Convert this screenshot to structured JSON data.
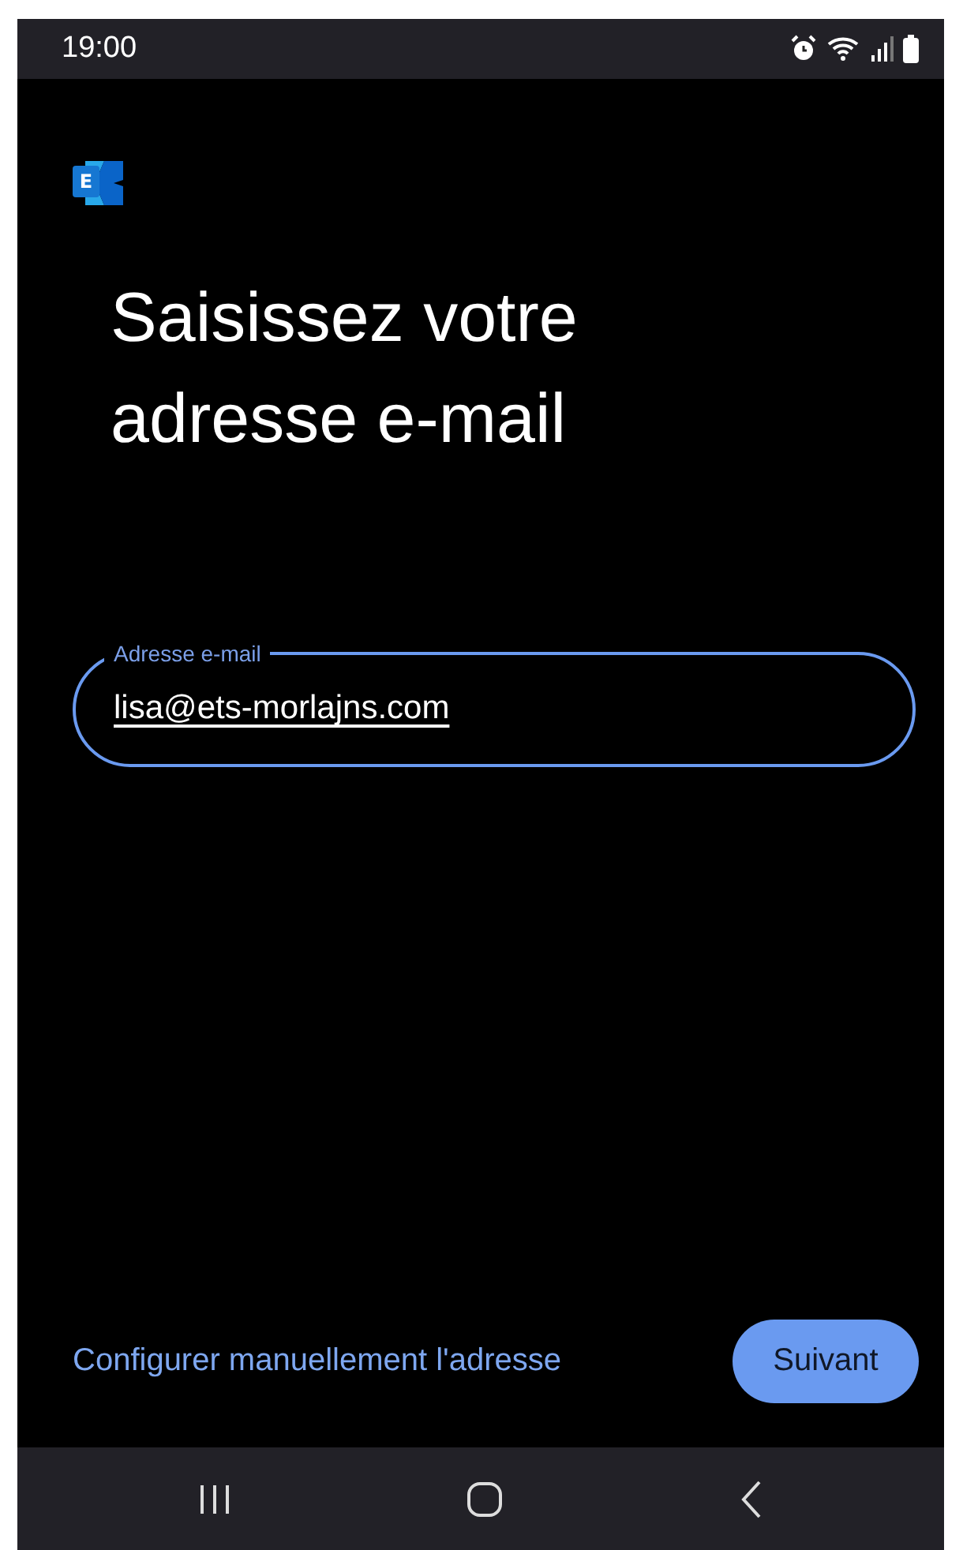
{
  "status_bar": {
    "time": "19:00"
  },
  "logo": {
    "letter": "E"
  },
  "title": "Saisissez votre adresse e-mail",
  "email_field": {
    "label": "Adresse e-mail",
    "value": "lisa@ets-morlajns.com",
    "focused": true
  },
  "manual_link": "Configurer manuellement l'adresse",
  "next_button": "Suivant"
}
